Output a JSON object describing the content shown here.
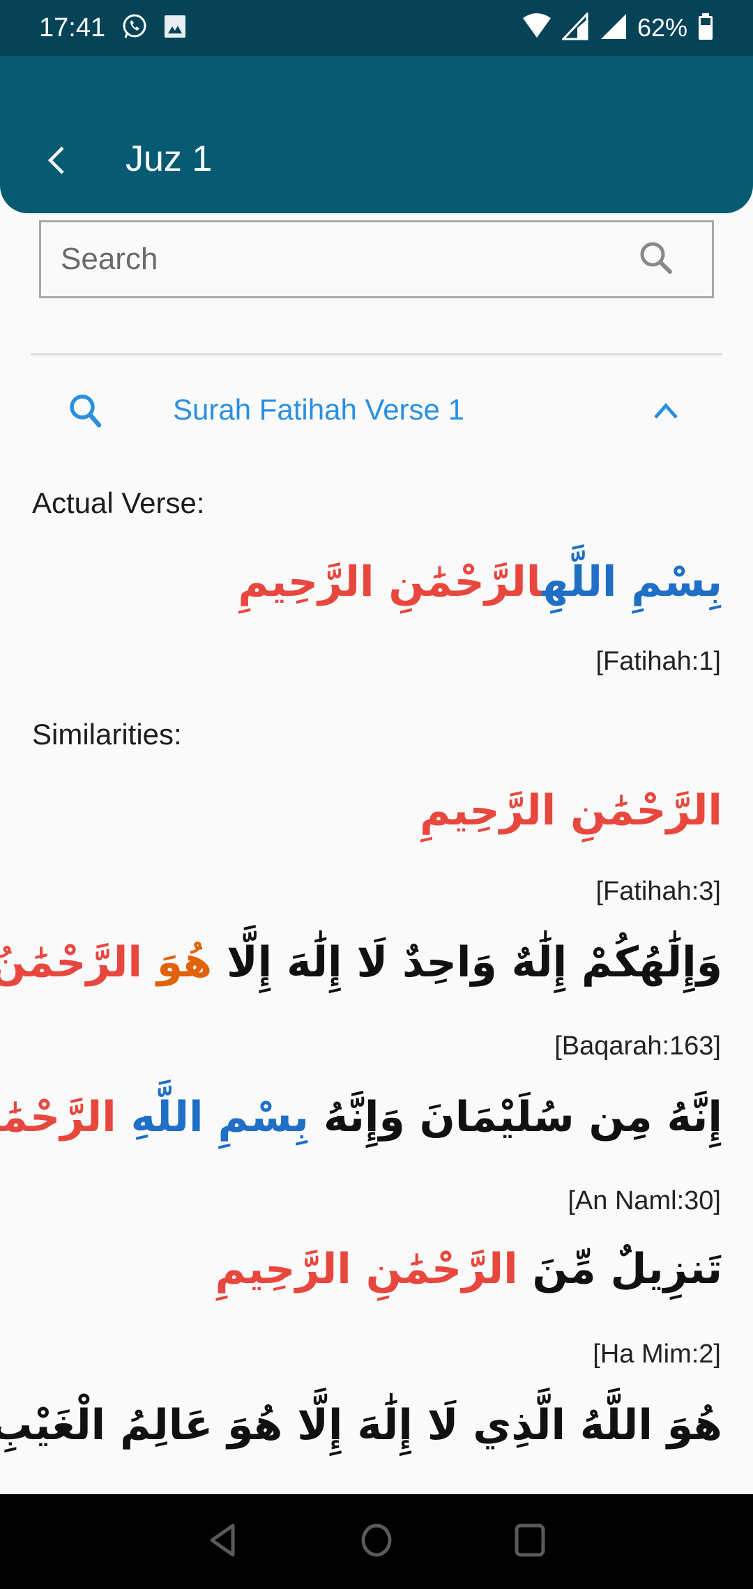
{
  "status_bar": {
    "time": "17:41",
    "notification_icons": [
      "whatsapp-icon",
      "image-icon"
    ],
    "system_icons": [
      "wifi-icon",
      "signal-icon",
      "signal-icon"
    ],
    "battery_percent": "62%"
  },
  "app_bar": {
    "title": "Juz 1",
    "back_icon": "chevron-left-icon"
  },
  "search": {
    "placeholder": "Search",
    "value": "",
    "icon": "search-icon"
  },
  "expander": {
    "title": "Surah Fatihah Verse 1",
    "leading_icon": "search-icon",
    "trailing_icon": "chevron-up-icon",
    "expanded": true
  },
  "actual_verse": {
    "label": "Actual Verse:",
    "segments": [
      {
        "text": "بِسْمِ اللَّهِ",
        "color": "blue"
      },
      {
        "text": "الرَّحْمَٰنِ الرَّحِيمِ",
        "color": "red"
      }
    ],
    "reference": "[Fatihah:1]"
  },
  "similarities": {
    "label": "Similarities:",
    "items": [
      {
        "segments": [
          {
            "text": "الرَّحْمَٰنِ الرَّحِيمِ",
            "color": "red"
          }
        ],
        "reference": "[Fatihah:3]"
      },
      {
        "segments": [
          {
            "text": "وَإِلَٰهُكُمْ إِلَٰهٌ وَاحِدٌ لَا إِلَٰهَ إِلَّا ",
            "color": "black"
          },
          {
            "text": "هُوَ ",
            "color": "orange"
          },
          {
            "text": "الرَّحْمَٰنُ الرَّحِيمُ",
            "color": "red"
          }
        ],
        "reference": "[Baqarah:163]"
      },
      {
        "segments": [
          {
            "text": "إِنَّهُ مِن سُلَيْمَانَ وَإِنَّهُ ",
            "color": "black"
          },
          {
            "text": "بِسْمِ اللَّهِ ",
            "color": "blue"
          },
          {
            "text": "الرَّحْمَٰنِ الرَّحِيمِ",
            "color": "red"
          }
        ],
        "reference": "[An Naml:30]"
      },
      {
        "segments": [
          {
            "text": "تَنزِيلٌ مِّنَ ",
            "color": "black"
          },
          {
            "text": "الرَّحْمَٰنِ الرَّحِيمِ",
            "color": "red"
          }
        ],
        "reference": "[Ha Mim:2]"
      },
      {
        "segments": [
          {
            "text": "هُوَ اللَّهُ الَّذِي لَا إِلَٰهَ إِلَّا هُوَ عَالِمُ الْغَيْبِ وَالشَّهَادَةِ",
            "color": "black"
          }
        ],
        "reference": ""
      }
    ]
  },
  "colors": {
    "status_bar": "#064357",
    "app_bar": "#065b72",
    "accent_blue": "#2a8fe0",
    "arabic_red": "#e8473e",
    "arabic_blue": "#1f6fc6",
    "arabic_orange": "#e0620c",
    "background": "#fafafa"
  },
  "nav_bar": {
    "buttons": [
      "back-triangle-icon",
      "home-circle-icon",
      "recents-square-icon"
    ]
  }
}
